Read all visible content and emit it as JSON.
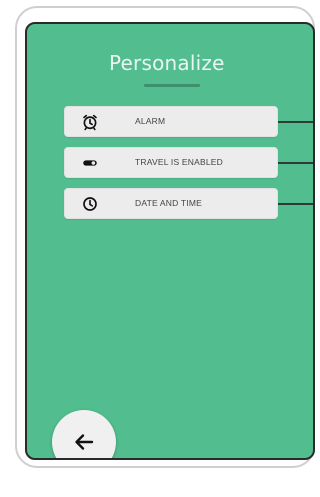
{
  "screen": {
    "title": "Personalize"
  },
  "menu": {
    "items": [
      {
        "label": "ALARM",
        "icon": "alarm-clock-icon"
      },
      {
        "label": "TRAVEL IS ENABLED",
        "icon": "toggle-switch-icon"
      },
      {
        "label": "DATE AND TIME",
        "icon": "clock-icon"
      }
    ]
  },
  "nav": {
    "back_icon": "arrow-left-icon"
  },
  "colors": {
    "background": "#52bd8f",
    "card": "#ececec",
    "title": "#eaf7f1",
    "accent_line": "#3f8f6d"
  }
}
